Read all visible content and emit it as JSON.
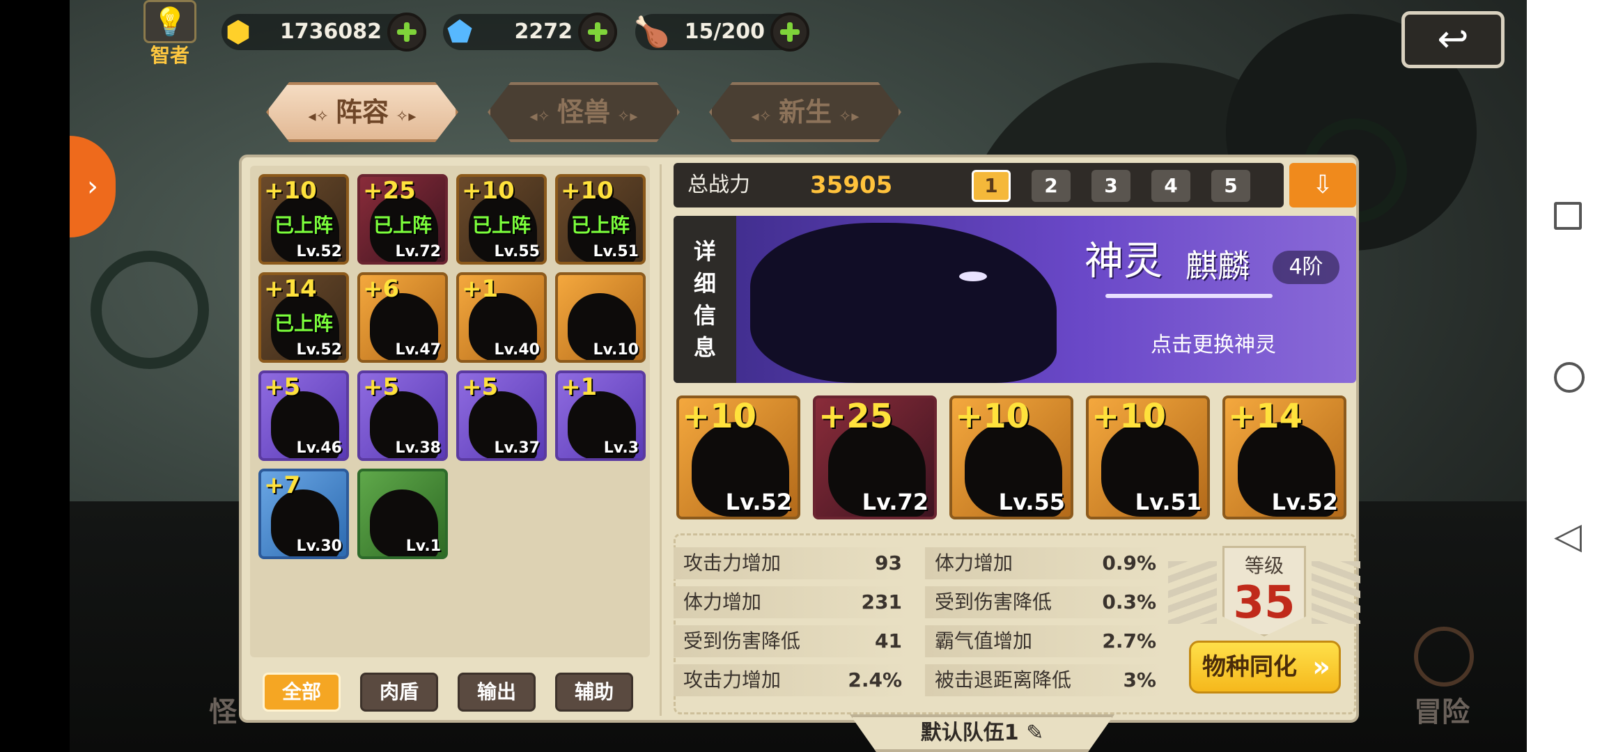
{
  "resources": {
    "badge_label": "智者",
    "gold": "1736082",
    "gems": "2272",
    "stamina": "15/200"
  },
  "tabs": [
    "阵容",
    "怪兽",
    "新生"
  ],
  "monsters": [
    {
      "plus": "+10",
      "level": "Lv.52",
      "deployed": "已上阵",
      "rarity": "dark"
    },
    {
      "plus": "+25",
      "level": "Lv.72",
      "deployed": "已上阵",
      "rarity": "red"
    },
    {
      "plus": "+10",
      "level": "Lv.55",
      "deployed": "已上阵",
      "rarity": "dark"
    },
    {
      "plus": "+10",
      "level": "Lv.51",
      "deployed": "已上阵",
      "rarity": "dark"
    },
    {
      "plus": "+14",
      "level": "Lv.52",
      "deployed": "已上阵",
      "rarity": "dark"
    },
    {
      "plus": "+6",
      "level": "Lv.47",
      "deployed": "",
      "rarity": "orange"
    },
    {
      "plus": "+1",
      "level": "Lv.40",
      "deployed": "",
      "rarity": "orange"
    },
    {
      "plus": "",
      "level": "Lv.10",
      "deployed": "",
      "rarity": "orange"
    },
    {
      "plus": "+5",
      "level": "Lv.46",
      "deployed": "",
      "rarity": "purple"
    },
    {
      "plus": "+5",
      "level": "Lv.38",
      "deployed": "",
      "rarity": "purple"
    },
    {
      "plus": "+5",
      "level": "Lv.37",
      "deployed": "",
      "rarity": "purple"
    },
    {
      "plus": "+1",
      "level": "Lv.3",
      "deployed": "",
      "rarity": "purple"
    },
    {
      "plus": "+7",
      "level": "Lv.30",
      "deployed": "",
      "rarity": "blue"
    },
    {
      "plus": "",
      "level": "Lv.1",
      "deployed": "",
      "rarity": "green"
    }
  ],
  "filters": [
    "全部",
    "肉盾",
    "输出",
    "辅助"
  ],
  "power": {
    "label": "总战力",
    "value": "35905",
    "teams": [
      "1",
      "2",
      "3",
      "4",
      "5"
    ],
    "selected_team": "1"
  },
  "god": {
    "detail_label": "详细信息",
    "title": "神灵",
    "name": "麒麟",
    "stage": "4阶",
    "tip": "点击更换神灵"
  },
  "team_slots": [
    {
      "plus": "+10",
      "level": "Lv.52"
    },
    {
      "plus": "+25",
      "level": "Lv.72"
    },
    {
      "plus": "+10",
      "level": "Lv.55"
    },
    {
      "plus": "+10",
      "level": "Lv.51"
    },
    {
      "plus": "+14",
      "level": "Lv.52"
    }
  ],
  "stats_left": [
    {
      "label": "攻击力增加",
      "value": "93"
    },
    {
      "label": "体力增加",
      "value": "231"
    },
    {
      "label": "受到伤害降低",
      "value": "41"
    },
    {
      "label": "攻击力增加",
      "value": "2.4%"
    }
  ],
  "stats_right": [
    {
      "label": "体力增加",
      "value": "0.9%"
    },
    {
      "label": "受到伤害降低",
      "value": "0.3%"
    },
    {
      "label": "霸气值增加",
      "value": "2.7%"
    },
    {
      "label": "被击退距离降低",
      "value": "3%"
    }
  ],
  "level": {
    "label": "等级",
    "value": "35"
  },
  "species_button": "物种同化",
  "team_name": "默认队伍1",
  "bottom_nav": {
    "left": "怪",
    "right": "冒险"
  }
}
